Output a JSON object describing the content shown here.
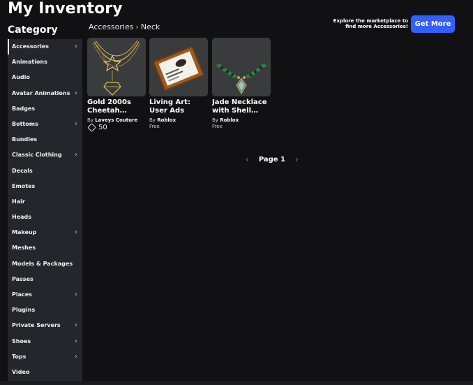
{
  "header": {
    "title": "My Inventory"
  },
  "sidebar": {
    "heading": "Category",
    "items": [
      {
        "label": "Accessories",
        "chevron": true,
        "active": true
      },
      {
        "label": "Animations",
        "chevron": false
      },
      {
        "label": "Audio",
        "chevron": false
      },
      {
        "label": "Avatar Animations",
        "chevron": true
      },
      {
        "label": "Badges",
        "chevron": false
      },
      {
        "label": "Bottoms",
        "chevron": true
      },
      {
        "label": "Bundles",
        "chevron": false
      },
      {
        "label": "Classic Clothing",
        "chevron": true
      },
      {
        "label": "Decals",
        "chevron": false
      },
      {
        "label": "Emotes",
        "chevron": false
      },
      {
        "label": "Hair",
        "chevron": false
      },
      {
        "label": "Heads",
        "chevron": false
      },
      {
        "label": "Makeup",
        "chevron": true
      },
      {
        "label": "Meshes",
        "chevron": false
      },
      {
        "label": "Models & Packages",
        "chevron": false
      },
      {
        "label": "Passes",
        "chevron": false
      },
      {
        "label": "Places",
        "chevron": true
      },
      {
        "label": "Plugins",
        "chevron": false
      },
      {
        "label": "Private Servers",
        "chevron": true
      },
      {
        "label": "Shoes",
        "chevron": true
      },
      {
        "label": "Tops",
        "chevron": true
      },
      {
        "label": "Video",
        "chevron": false
      }
    ],
    "chevron_glyph": "›"
  },
  "breadcrumb": {
    "parent": "Accessories",
    "separator": "›",
    "current": "Neck"
  },
  "promo": {
    "text": "Explore the marketplace to find more Accessories!",
    "button": "Get More"
  },
  "items": [
    {
      "name": "Gold 2000s Cheetah…",
      "by": "By",
      "creator": "Laveys Couture",
      "price": "50",
      "price_type": "robux"
    },
    {
      "name": "Living Art: User Ads",
      "by": "By",
      "creator": "Roblox",
      "price": "Free",
      "price_type": "free"
    },
    {
      "name": "Jade Necklace with Shell…",
      "by": "By",
      "creator": "Roblox",
      "price": "Free",
      "price_type": "free"
    }
  ],
  "pagination": {
    "prev": "‹",
    "label": "Page 1",
    "next": "›"
  },
  "colors": {
    "background": "#111114",
    "sidebar": "#24262b",
    "card": "#393b3d",
    "accent": "#335fff"
  }
}
